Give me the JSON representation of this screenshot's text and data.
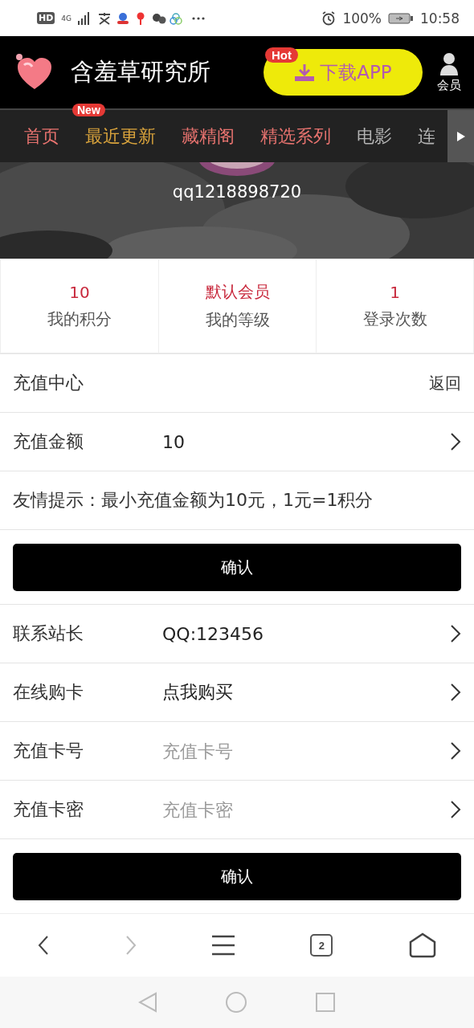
{
  "status_bar": {
    "left": [
      "HD",
      "4G"
    ],
    "battery": "100%",
    "time": "10:58"
  },
  "header": {
    "site_title": "含羞草研究所",
    "download": {
      "badge": "Hot",
      "label": "下载APP"
    },
    "member": "会员"
  },
  "nav": [
    {
      "label": "首页",
      "color": "#e8736f"
    },
    {
      "label": "最近更新",
      "color": "#d9a33c",
      "badge": "New"
    },
    {
      "label": "藏精阁",
      "color": "#e8736f"
    },
    {
      "label": "精选系列",
      "color": "#e8736f"
    },
    {
      "label": "电影",
      "color": "#b4b4b4"
    },
    {
      "label": "连",
      "color": "#b4b4b4"
    }
  ],
  "profile": {
    "username": "qq1218898720"
  },
  "stats": [
    {
      "value": "10",
      "label": "我的积分"
    },
    {
      "value": "默认会员",
      "label": "我的等级"
    },
    {
      "value": "1",
      "label": "登录次数"
    }
  ],
  "rows": [
    {
      "kind": "header",
      "label": "充值中心",
      "action": "返回"
    },
    {
      "kind": "value",
      "label": "充值金额",
      "value": "10"
    },
    {
      "kind": "note",
      "text": "友情提示：最小充值金额为10元，1元=1积分"
    },
    {
      "kind": "button",
      "label": "确认"
    },
    {
      "kind": "value",
      "label": "联系站长",
      "value": "QQ:123456"
    },
    {
      "kind": "value",
      "label": "在线购卡",
      "value": "点我购买"
    },
    {
      "kind": "field",
      "label": "充值卡号",
      "placeholder": "充值卡号"
    },
    {
      "kind": "field",
      "label": "充值卡密",
      "placeholder": "充值卡密"
    },
    {
      "kind": "button",
      "label": "确认"
    }
  ],
  "browser_bar": {
    "tab_count": "2"
  }
}
